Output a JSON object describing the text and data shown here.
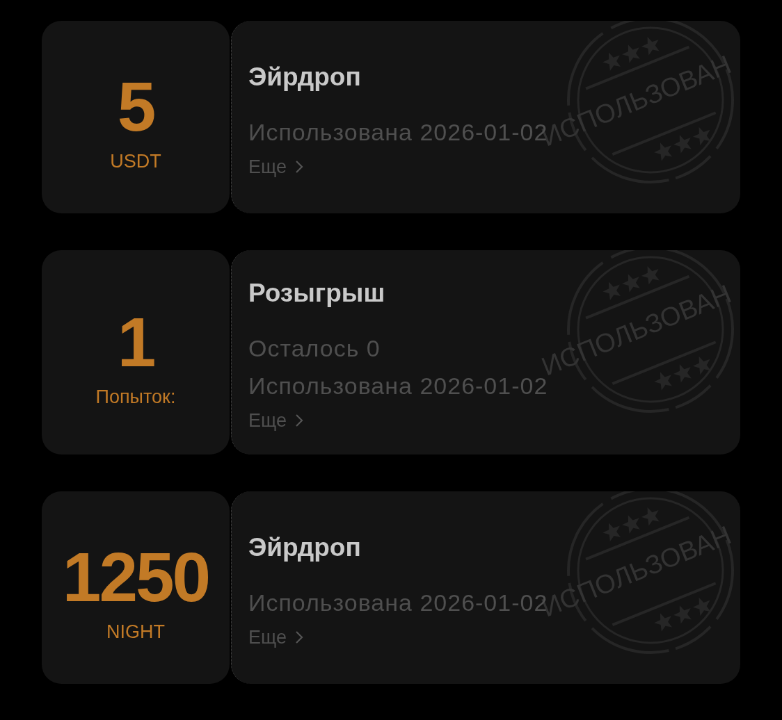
{
  "coupons": [
    {
      "amount": "5",
      "unit": "USDT",
      "title": "Эйрдроп",
      "details": [
        "Использована 2026-01-02"
      ],
      "more": "Еще",
      "stamp": "ИСПОЛЬЗОВАН"
    },
    {
      "amount": "1",
      "unit": "Попыток:",
      "title": "Розыгрыш",
      "details": [
        "Осталось 0",
        "Использована 2026-01-02"
      ],
      "more": "Еще",
      "stamp": "ИСПОЛЬЗОВАН"
    },
    {
      "amount": "1250",
      "unit": "NIGHT",
      "title": "Эйрдроп",
      "details": [
        "Использована 2026-01-02"
      ],
      "more": "Еще",
      "stamp": "ИСПОЛЬЗОВАН"
    }
  ]
}
